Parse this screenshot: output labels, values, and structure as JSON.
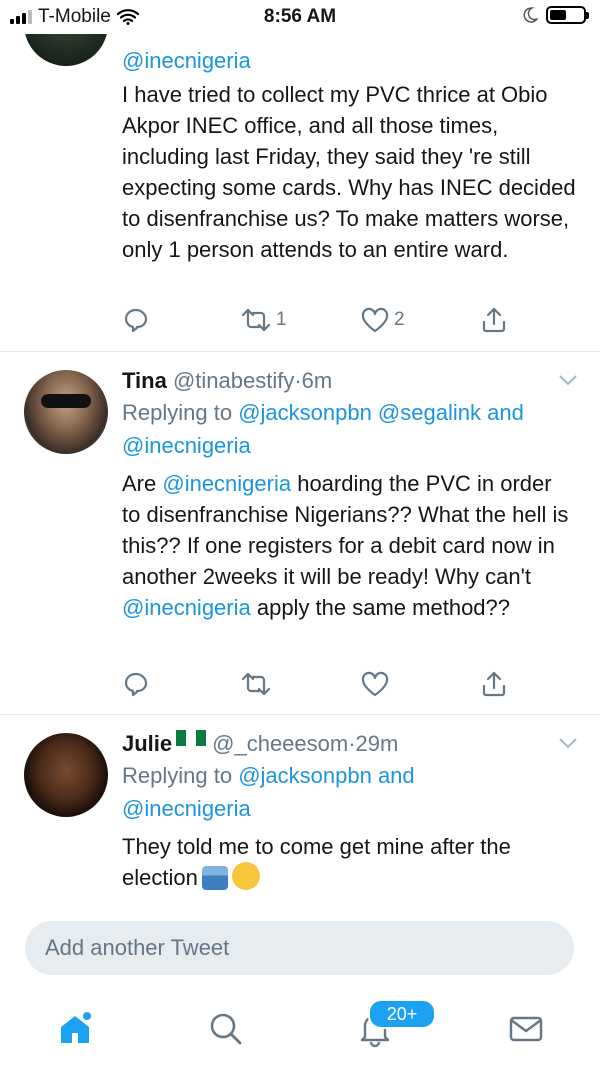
{
  "status_bar": {
    "carrier": "T-Mobile",
    "time": "8:56 AM"
  },
  "tweets": [
    {
      "reply_to": "@inecnigeria",
      "text": "I have tried to collect my PVC thrice at Obio Akpor INEC office, and all those times, including last Friday, they said they 're still expecting some cards. Why has INEC decided to disenfranchise us? To make matters worse, only 1 person attends to an entire ward.",
      "retweets": "1",
      "likes": "2"
    },
    {
      "name": "Tina",
      "handle": "@tinabestify",
      "time": "6m",
      "replying_prefix": "Replying to ",
      "replying_users": "@jacksonpbn @segalink",
      "replying_and": " and",
      "replying_last": "@inecnigeria",
      "text_parts": [
        "Are ",
        "@inecnigeria",
        " hoarding the PVC in order to disenfranchise Nigerians?? What the hell is this?? If one registers for a debit card now in another 2weeks it will be ready! Why can't ",
        "@inecnigeria",
        " apply the same method??"
      ]
    },
    {
      "name": "Julie",
      "handle": "@_cheeesom",
      "time": "29m",
      "replying_prefix": "Replying to ",
      "replying_users": "@jacksonpbn",
      "replying_and": " and",
      "replying_last": "@inecnigeria",
      "text": "They told me to come get mine after the election"
    }
  ],
  "compose": {
    "placeholder": "Add another Tweet"
  },
  "tabbar": {
    "notifications_badge": "20+"
  },
  "colors": {
    "link": "#1b95e0",
    "accent": "#1da1f2",
    "muted": "#657786",
    "divider": "#e1e8ed"
  },
  "icons": [
    "signal-icon",
    "wifi-icon",
    "moon-icon",
    "battery-icon",
    "reply-icon",
    "retweet-icon",
    "like-icon",
    "share-icon",
    "chevron-down-icon",
    "home-icon",
    "search-icon",
    "notifications-icon",
    "messages-icon"
  ]
}
